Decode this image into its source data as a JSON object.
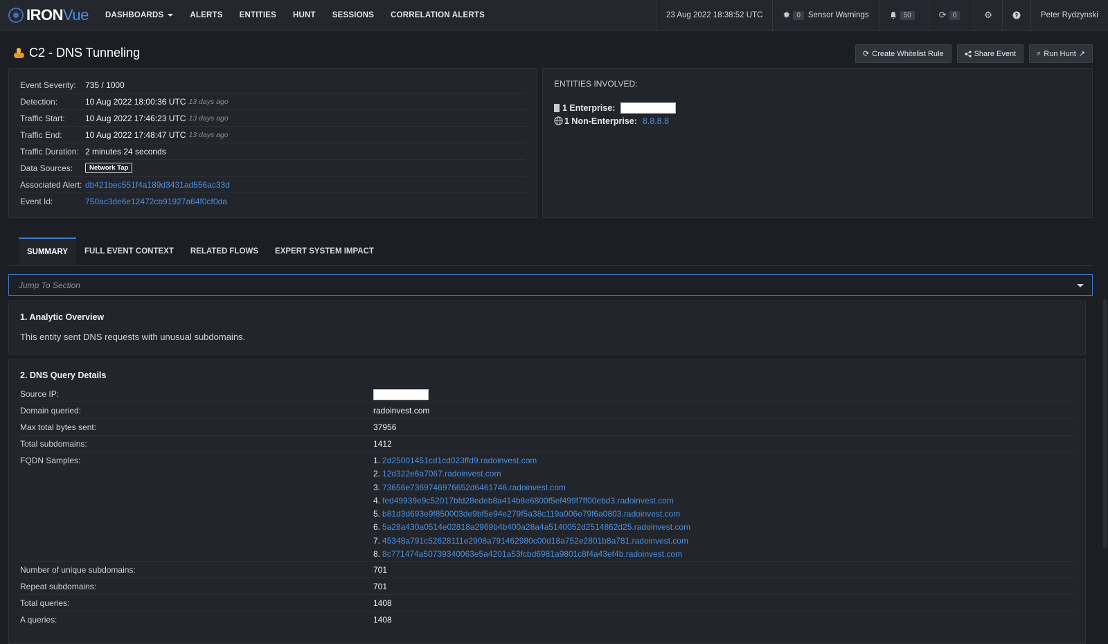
{
  "brand": {
    "iron": "IRON",
    "vue": "Vue"
  },
  "nav": [
    {
      "label": "DASHBOARDS",
      "caret": true
    },
    {
      "label": "ALERTS"
    },
    {
      "label": "ENTITIES"
    },
    {
      "label": "HUNT"
    },
    {
      "label": "SESSIONS"
    },
    {
      "label": "CORRELATION ALERTS"
    }
  ],
  "topbar": {
    "datetime": "23 Aug 2022 18:38:52 UTC",
    "sensor_count": "0",
    "sensor_label": "Sensor Warnings",
    "notif_count": "50",
    "refresh_count": "0",
    "user": "Peter Rydzynski"
  },
  "page": {
    "title": "C2 - DNS Tunneling"
  },
  "actions": {
    "whitelist": "Create Whitelist Rule",
    "share": "Share Event",
    "run_hunt": "Run Hunt"
  },
  "event": {
    "severity_label": "Event Severity:",
    "severity": "735 / 1000",
    "detection_label": "Detection:",
    "detection": "10 Aug 2022 18:00:36 UTC",
    "detection_ago": "13 days ago",
    "traffic_start_label": "Traffic Start:",
    "traffic_start": "10 Aug 2022 17:46:23 UTC",
    "traffic_start_ago": "13 days ago",
    "traffic_end_label": "Traffic End:",
    "traffic_end": "10 Aug 2022 17:48:47 UTC",
    "traffic_end_ago": "13 days ago",
    "duration_label": "Traffic Duration:",
    "duration": "2 minutes 24 seconds",
    "sources_label": "Data Sources:",
    "source_tag": "Network Tap",
    "alert_label": "Associated Alert:",
    "alert_id": "db421bec551f4a189d3431ad556ac33d",
    "event_label": "Event Id:",
    "event_id": "750ac3de6e12472cb91927a64f0cf0da"
  },
  "entities": {
    "title": "ENTITIES INVOLVED:",
    "enterprise_label": "1 Enterprise:",
    "non_enterprise_label": "1 Non-Enterprise:",
    "non_enterprise_value": "8.8.8.8"
  },
  "tabs": [
    "SUMMARY",
    "FULL EVENT CONTEXT",
    "RELATED FLOWS",
    "EXPERT SYSTEM IMPACT"
  ],
  "jump": {
    "placeholder": "Jump To Section"
  },
  "overview": {
    "title": "1. Analytic Overview",
    "text": "This entity sent DNS requests with unusual subdomains."
  },
  "dns": {
    "title": "2. DNS Query Details",
    "source_ip_label": "Source IP:",
    "domain_label": "Domain queried:",
    "domain": "radoinvest.com",
    "max_bytes_label": "Max total bytes sent:",
    "max_bytes": "37956",
    "total_sub_label": "Total subdomains:",
    "total_sub": "1412",
    "fqdn_label": "FQDN Samples:",
    "fqdn": [
      "2d25001451cd1cd023ffd9.radoinvest.com",
      "12d322e6a7067.radoinvest.com",
      "73656e7369746976652d6461746.radoinvest.com",
      "fed49939e9c52017bfd28edeb8a414b8e6800f5ef499f7ff00ebd3.radoinvest.com",
      "b81d3d693e9f850003de9bf5e94e279f5a38c119a006e79f6a0803.radoinvest.com",
      "5a28a430a0514e02818a2969b4b400a28a4a5140052d2514862d25.radoinvest.com",
      "45348a791c52628111e2908a791462980c00d18a752e2801b8a781.radoinvest.com",
      "8c771474a50739340063e5a4201a53fcbd6981a9801c8f4a43ef4b.radoinvest.com"
    ],
    "unique_label": "Number of unique subdomains:",
    "unique": "701",
    "repeat_label": "Repeat subdomains:",
    "repeat": "701",
    "total_q_label": "Total queries:",
    "total_q": "1408",
    "a_q_label": "A queries:",
    "a_q": "1408"
  }
}
